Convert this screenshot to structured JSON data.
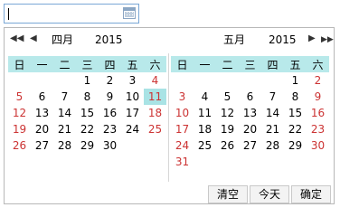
{
  "date_input": {
    "value": ""
  },
  "left": {
    "month": "四月",
    "year": "2015",
    "nav_prev_year": "◀◀",
    "nav_prev_month": "◀",
    "weekdays": [
      "日",
      "一",
      "二",
      "三",
      "四",
      "五",
      "六"
    ],
    "weeks": [
      [
        "",
        "",
        "",
        "1",
        "2",
        "3",
        "4"
      ],
      [
        "5",
        "6",
        "7",
        "8",
        "9",
        "10",
        "11"
      ],
      [
        "12",
        "13",
        "14",
        "15",
        "16",
        "17",
        "18"
      ],
      [
        "19",
        "20",
        "21",
        "22",
        "23",
        "24",
        "25"
      ],
      [
        "26",
        "27",
        "28",
        "29",
        "30",
        "",
        ""
      ],
      [
        "",
        "",
        "",
        "",
        "",
        "",
        ""
      ]
    ],
    "today": "11"
  },
  "right": {
    "month": "五月",
    "year": "2015",
    "nav_next_month": "▶",
    "nav_next_year": "▶▶",
    "weekdays": [
      "日",
      "一",
      "二",
      "三",
      "四",
      "五",
      "六"
    ],
    "weeks": [
      [
        "",
        "",
        "",
        "",
        "",
        "1",
        "2"
      ],
      [
        "3",
        "4",
        "5",
        "6",
        "7",
        "8",
        "9"
      ],
      [
        "10",
        "11",
        "12",
        "13",
        "14",
        "15",
        "16"
      ],
      [
        "17",
        "18",
        "19",
        "20",
        "21",
        "22",
        "23"
      ],
      [
        "24",
        "25",
        "26",
        "27",
        "28",
        "29",
        "30"
      ],
      [
        "31",
        "",
        "",
        "",
        "",
        "",
        ""
      ]
    ]
  },
  "footer": {
    "clear": "清空",
    "today": "今天",
    "confirm": "确定"
  },
  "colors": {
    "header_bg": "#b8e9ea",
    "today_bg": "#a9e3e5",
    "weekend": "#cc3333",
    "input_border": "#7aa7d6"
  }
}
